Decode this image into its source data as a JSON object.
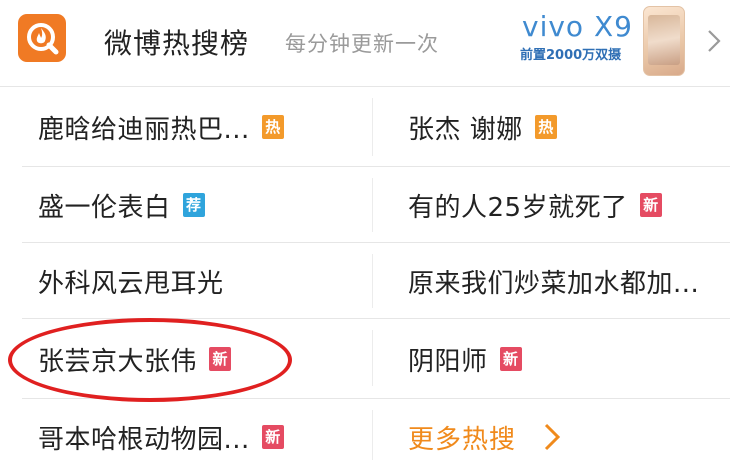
{
  "header": {
    "title": "微博热搜榜",
    "subtitle": "每分钟更新一次",
    "ad_brand": "vivo X9",
    "ad_slogan": "前置2000万双摄"
  },
  "items": [
    {
      "text": "鹿晗给迪丽热巴...",
      "badge": "热",
      "badge_type": "hot"
    },
    {
      "text": "张杰 谢娜",
      "badge": "热",
      "badge_type": "hot"
    },
    {
      "text": "盛一伦表白",
      "badge": "荐",
      "badge_type": "recommend"
    },
    {
      "text": "有的人25岁就死了",
      "badge": "新",
      "badge_type": "new"
    },
    {
      "text": "外科风云甩耳光",
      "badge": "",
      "badge_type": "none"
    },
    {
      "text": "原来我们炒菜加水都加...",
      "badge": "",
      "badge_type": "none"
    },
    {
      "text": "张芸京大张伟",
      "badge": "新",
      "badge_type": "new"
    },
    {
      "text": "阴阳师",
      "badge": "新",
      "badge_type": "new"
    },
    {
      "text": "哥本哈根动物园...",
      "badge": "新",
      "badge_type": "new"
    }
  ],
  "more": {
    "label": "更多热搜"
  },
  "colors": {
    "hot": "#f39a2b",
    "recommend": "#2fa4dc",
    "new": "#e54b62",
    "logo": "#f07a24",
    "more": "#f08a1c",
    "highlight": "#e02020"
  },
  "icons": {
    "logo": "weibo-hot-search-icon",
    "chevron": "chevron-right-icon"
  }
}
